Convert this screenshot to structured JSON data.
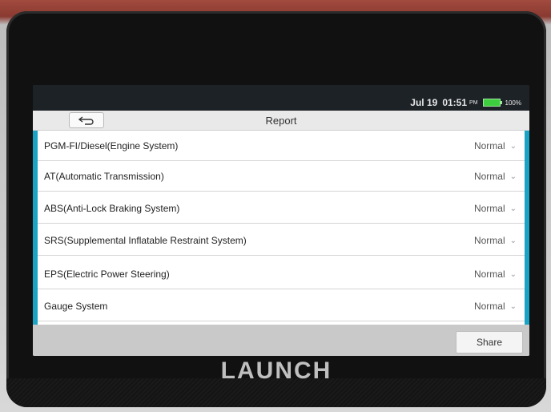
{
  "statusbar": {
    "date": "Jul 19",
    "time": "01:51",
    "ampm": "PM",
    "battery_percent": "100%"
  },
  "header": {
    "title": "Report",
    "back_icon": "back-arrow-icon"
  },
  "systems": [
    {
      "name": "PGM-FI/Diesel(Engine System)",
      "status": "Normal"
    },
    {
      "name": "AT(Automatic Transmission)",
      "status": "Normal"
    },
    {
      "name": "ABS(Anti-Lock Braking System)",
      "status": "Normal"
    },
    {
      "name": "SRS(Supplemental Inflatable Restraint System)",
      "status": "Normal"
    },
    {
      "name": "EPS(Electric Power Steering)",
      "status": "Normal"
    },
    {
      "name": "Gauge System",
      "status": "Normal"
    }
  ],
  "footer": {
    "share_label": "Share"
  },
  "device": {
    "brand": "LAUNCH"
  },
  "colors": {
    "accent": "#1aa3c4",
    "battery": "#3ecf3e",
    "list_bg": "#ffffff",
    "footer_bg": "#c9c9c9"
  }
}
